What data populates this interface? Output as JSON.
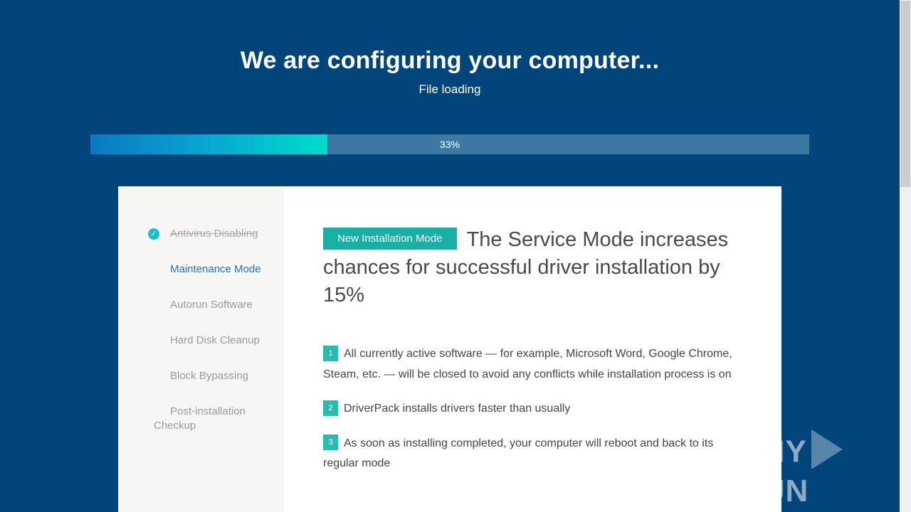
{
  "header": {
    "title": "We are configuring your computer...",
    "subtitle": "File loading"
  },
  "progress": {
    "value_percent": 33,
    "label": "33%"
  },
  "sidebar": {
    "steps": [
      {
        "label": "Antivirus Disabling",
        "state": "done"
      },
      {
        "label": "Maintenance Mode",
        "state": "active"
      },
      {
        "label": "Autorun Software",
        "state": "pending"
      },
      {
        "label": "Hard Disk Cleanup",
        "state": "pending"
      },
      {
        "label": "Block Bypassing",
        "state": "pending"
      },
      {
        "label": "Post-installation Checkup",
        "state": "pending"
      }
    ]
  },
  "content": {
    "badge": "New Installation Mode",
    "headline": "The Service Mode increases chances for successful driver installation by 15%",
    "points": [
      {
        "num": "1",
        "text": "All currently active software — for example, Microsoft Word, Google Chrome, Steam, etc. — will be closed to avoid any conflicts while installation process is on"
      },
      {
        "num": "2",
        "text": "DriverPack installs drivers faster than usually"
      },
      {
        "num": "3",
        "text": "As soon as installing completed, your computer will reboot and back to its regular mode"
      }
    ]
  },
  "watermark": {
    "left": "ANY",
    "right": "RUN"
  },
  "colors": {
    "background": "#01457a",
    "progress_track": "#3c7aa3",
    "progress_fill_start": "#0a78c2",
    "progress_fill_end": "#00dccc",
    "accent_teal": "#16b0a4",
    "active_step": "#1b73b8"
  },
  "icons": {
    "done_step": "check-circle-icon"
  }
}
